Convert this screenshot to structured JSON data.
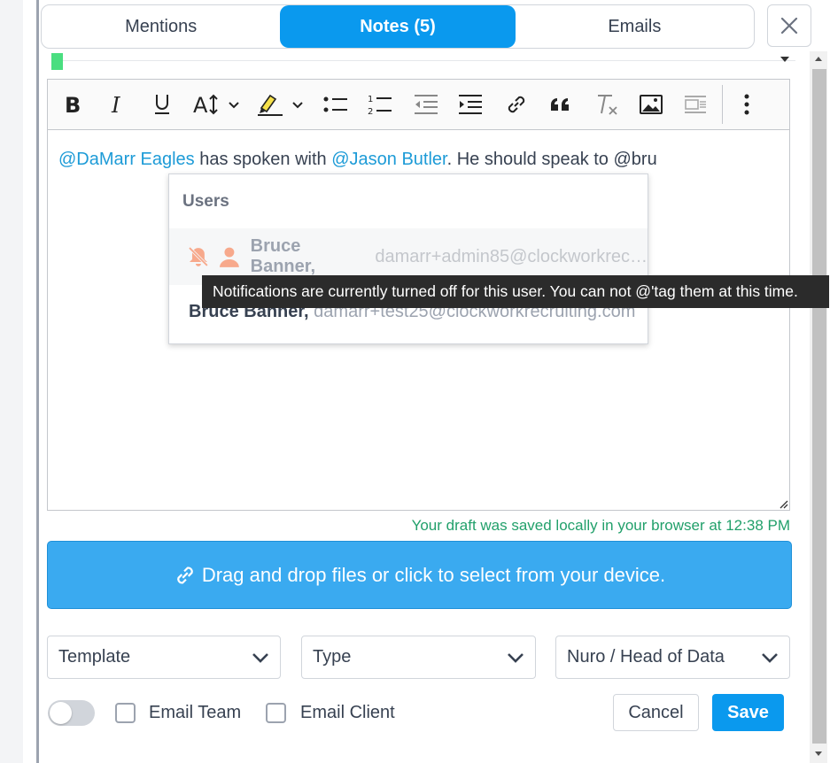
{
  "tabs": [
    {
      "label": "Mentions",
      "active": false
    },
    {
      "label": "Notes (5)",
      "active": true
    },
    {
      "label": "Emails",
      "active": false
    }
  ],
  "toolbar": {
    "icons": [
      "bold-icon",
      "italic-icon",
      "underline-icon",
      "font-size-icon",
      "highlight-icon",
      "bulleted-list-icon",
      "numbered-list-icon",
      "outdent-icon",
      "indent-icon",
      "link-icon",
      "blockquote-icon",
      "remove-format-icon",
      "image-icon",
      "media-embed-icon",
      "more-options-icon"
    ]
  },
  "editor": {
    "mention1": "@DaMarr Eagles",
    "text1": " has spoken with ",
    "mention2": "@Jason Butler",
    "text2": ". He should speak to @bru"
  },
  "mention_popup": {
    "header": "Users",
    "items": [
      {
        "name": "Bruce Banner,",
        "email": "damarr+admin85@clockworkrec…",
        "notifications_off": true
      },
      {
        "name": "Bruce Banner,",
        "email": "damarr+test25@clockworkrecruiting.com",
        "notifications_off": false
      }
    ]
  },
  "tooltip": "Notifications are currently turned off for this user. You can not @'tag them at this time.",
  "draft_status": "Your draft was saved locally in your browser at 12:38 PM",
  "dropzone": {
    "label": "Drag and drop files or click to select from your device."
  },
  "selects": {
    "template": "Template",
    "type": "Type",
    "project": "Nuro / Head of Data"
  },
  "checkboxes": {
    "email_team": "Email Team",
    "email_client": "Email Client"
  },
  "buttons": {
    "cancel": "Cancel",
    "save": "Save"
  },
  "colors": {
    "accent": "#0a99ee",
    "mention": "#1d9bd7",
    "dropzone": "#3aaaf0",
    "success": "#22a06b",
    "muted_user_icon": "#f7a98c"
  }
}
